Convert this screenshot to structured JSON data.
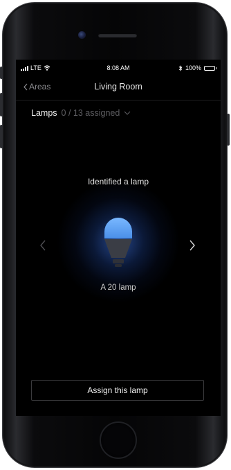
{
  "status_bar": {
    "carrier": "LTE",
    "time": "8:08 AM",
    "battery_percent": "100%",
    "signal_bars": 4,
    "battery_level": 1.0
  },
  "navbar": {
    "back_label": "Areas",
    "title": "Living Room"
  },
  "lamps": {
    "label": "Lamps",
    "assigned": "0 / 13 assigned"
  },
  "identify": {
    "message": "Identified a lamp",
    "lamp_name": "A 20 lamp"
  },
  "assign_button": "Assign this lamp",
  "colors": {
    "glow": "#3f7dff",
    "bulb_top": "#5aa6ff",
    "bulb_base": "#3a3d45"
  },
  "icons": {
    "back": "chevron-left-icon",
    "dropdown": "chevron-down-icon",
    "prev": "chevron-left-icon",
    "next": "chevron-right-icon",
    "bulb": "light-bulb-icon",
    "wifi": "wifi-icon",
    "bluetooth": "bluetooth-icon",
    "battery": "battery-icon"
  }
}
